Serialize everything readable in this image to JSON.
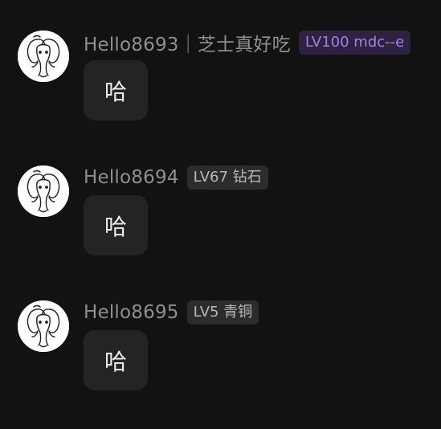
{
  "messages": [
    {
      "username": "Hello8693｜芝士真好吃",
      "badge": "LV100 mdc--e",
      "badge_color": "#a87de6",
      "text": "哈",
      "avatar_icon": "elephant-icon"
    },
    {
      "username": "Hello8694",
      "badge": "LV67 钻石",
      "badge_color": "#b8b8b8",
      "text": "哈",
      "avatar_icon": "elephant-icon"
    },
    {
      "username": "Hello8695",
      "badge": "LV5 青铜",
      "badge_color": "#b8b8b8",
      "text": "哈",
      "avatar_icon": "elephant-icon"
    }
  ]
}
